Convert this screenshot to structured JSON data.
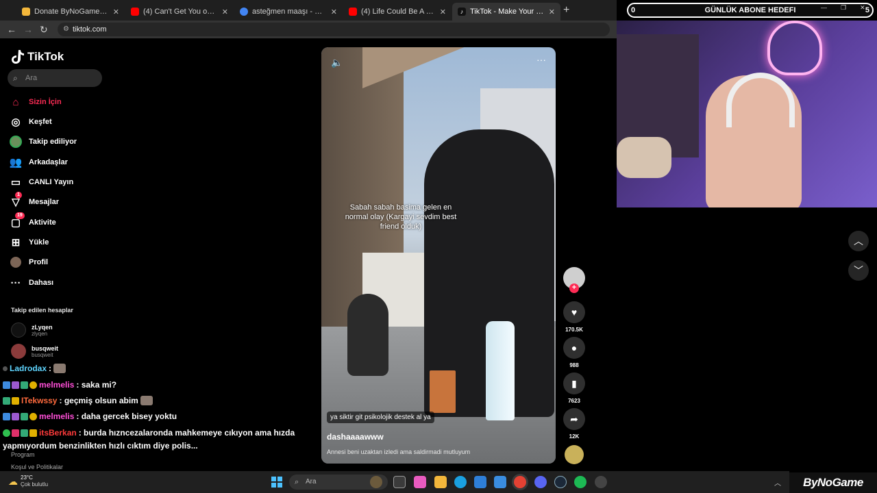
{
  "browser": {
    "tabs": [
      {
        "title": "Donate ByNoGame | Donations",
        "color": "#f3b73b"
      },
      {
        "title": "(4) Can't Get You out of My He...",
        "color": "#ff0000"
      },
      {
        "title": "asteğmen maaşı - Google'da Ara",
        "color": "#4285f4"
      },
      {
        "title": "(4) Life Could Be A Dream - You...",
        "color": "#ff0000"
      },
      {
        "title": "TikTok - Make Your Day",
        "color": "#ffffff"
      }
    ],
    "url": "tiktok.com"
  },
  "sidebar": {
    "logo": "TikTok",
    "search_placeholder": "Ara",
    "items": [
      {
        "label": "Sizin İçin",
        "icon": "home-icon"
      },
      {
        "label": "Keşfet",
        "icon": "compass-icon"
      },
      {
        "label": "Takip ediliyor",
        "icon": "following-icon"
      },
      {
        "label": "Arkadaşlar",
        "icon": "friends-icon"
      },
      {
        "label": "CANLI Yayın",
        "icon": "live-icon"
      },
      {
        "label": "Mesajlar",
        "icon": "message-icon",
        "badge": "1"
      },
      {
        "label": "Aktivite",
        "icon": "activity-icon",
        "badge": "19"
      },
      {
        "label": "Yükle",
        "icon": "upload-icon"
      },
      {
        "label": "Profil",
        "icon": "profile-icon"
      },
      {
        "label": "Dahası",
        "icon": "more-icon"
      }
    ],
    "following_header": "Takip edilen hesaplar",
    "accounts": [
      {
        "name": "zLyqen",
        "handle": "zlyqen"
      },
      {
        "name": "busqweit",
        "handle": "busqweit"
      }
    ],
    "footer": [
      "Program",
      "Koşul ve Politikalar"
    ]
  },
  "chat": [
    {
      "user": "Ladrodax",
      "color": "#5fd5ff",
      "text": ":"
    },
    {
      "user": "melmelis",
      "color": "#ff4fd8",
      "text": ": saka mi?"
    },
    {
      "user": "ITekwssy",
      "color": "#ff6a3d",
      "text": ": geçmiş olsun abim"
    },
    {
      "user": "melmelis",
      "color": "#ff4fd8",
      "text": ": daha gercek bisey yoktu"
    },
    {
      "user": "itsBerkan",
      "color": "#ff3b3b",
      "text": ": burda hızncezalaronda mahkemeye cıkıyon ama hızda"
    },
    {
      "user": "",
      "color": "#ffffff",
      "text": "yapmıyordum benzinlikten hızlı cıktım diye polis..."
    }
  ],
  "video": {
    "overlay_text": "Sabah sabah basima gelen en normal olay (Kargayi sevdim best friend olduk)",
    "sticker": "ya siktir git psikolojik destek al ya",
    "author": "dashaaaawww",
    "caption": "Annesi beni uzaktan izledi ama saldirmadi mutluyum"
  },
  "actions": {
    "likes": "170.5K",
    "comments": "988",
    "saves": "7623",
    "shares": "12K"
  },
  "stream": {
    "goal_left": "0",
    "goal_title": "GÜNLÜK ABONE HEDEFI",
    "goal_right": "5",
    "brand": "ByNoGame"
  },
  "taskbar": {
    "temp": "23°C",
    "weather": "Çok bulutlu",
    "search": "Ara"
  }
}
